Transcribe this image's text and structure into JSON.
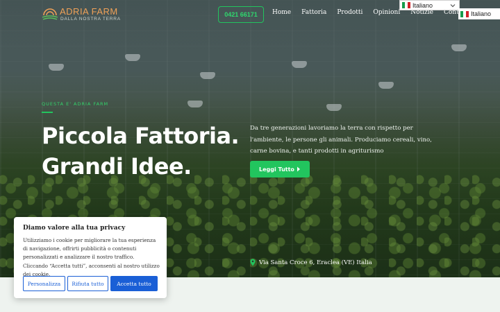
{
  "header": {
    "logo_title": "ADRIA FARM",
    "logo_subtitle": "DALLA NOSTRA TERRA",
    "phone": "0421 66171",
    "nav": [
      "Home",
      "Fattoria",
      "Prodotti",
      "Opinioni",
      "Notizie",
      "Contatti"
    ],
    "language_select": "Italiano",
    "language_badge": "Italiano"
  },
  "hero": {
    "eyebrow": "QUESTA E' ADRIA FARM",
    "headline_line1": "Piccola Fattoria.",
    "headline_line2": "Grandi Idee.",
    "description": "Da tre generazioni lavoriamo la terra con rispetto per l'ambiente, le persone gli animali. Produciamo cereali, vino, carne bovina, e tanti prodotti in agriturismo",
    "cta_label": "Leggi Tutto",
    "address": "Via Santa Croce 6, Eraclea (VE) Italia"
  },
  "cookie": {
    "title": "Diamo valore alla tua privacy",
    "text": "Utilizziamo i cookie per migliorare la tua esperienza di navigazione, offrirti pubblicità o contenuti personalizzati e analizzare il nostro traffico. Cliccando “Accetta tutti”, acconsenti al nostro utilizzo dei cookie.",
    "btn_customize": "Personalizza",
    "btn_reject": "Rifiuta tutto",
    "btn_accept": "Accetta tutto"
  },
  "colors": {
    "accent_green": "#22c55e",
    "logo_orange": "#f0a258",
    "cookie_blue": "#1a5fd6",
    "flag_green": "#169b4c",
    "flag_white": "#ffffff",
    "flag_red": "#d2232b"
  },
  "icons": {
    "flag": "italian-flag-icon",
    "dropdown": "chevron-down-icon",
    "cta_arrow": "caret-right-icon",
    "address": "map-pin-icon",
    "logo": "sunrise-field-logo-icon"
  }
}
